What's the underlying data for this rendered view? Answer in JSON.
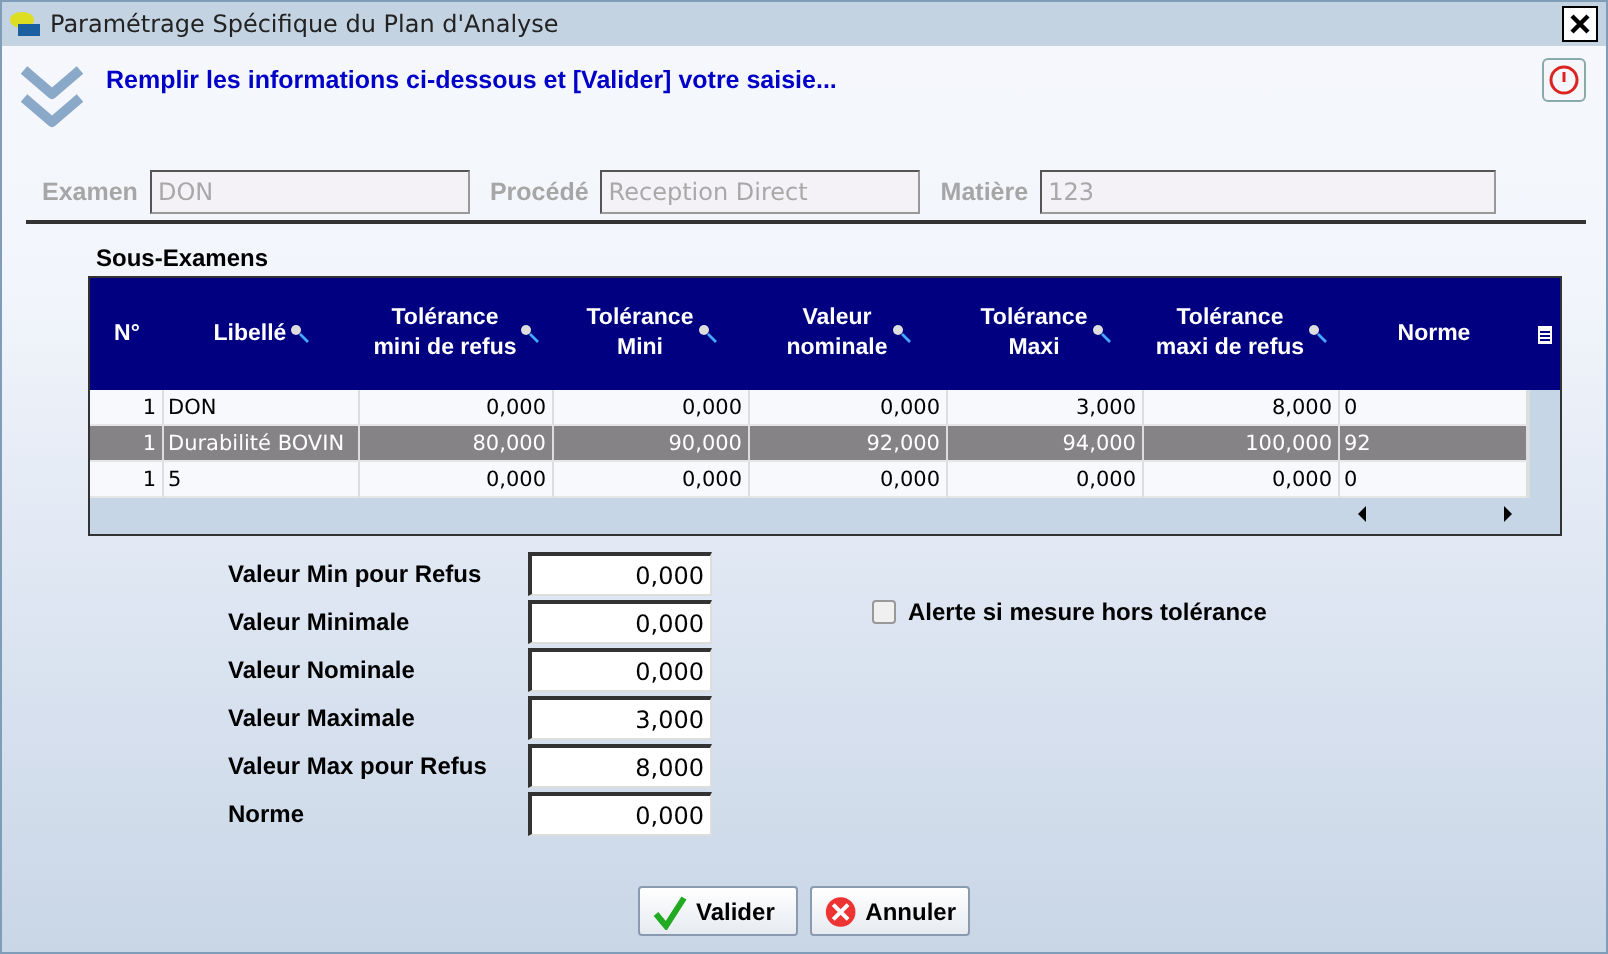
{
  "window": {
    "title": "Paramétrage Spécifique du Plan d'Analyse"
  },
  "instruction": "Remplir les informations ci-dessous et [Valider] votre saisie...",
  "header_fields": [
    {
      "label": "Examen",
      "value": "DON",
      "disabled": true
    },
    {
      "label": "Procédé",
      "value": "Reception Direct",
      "disabled": true
    },
    {
      "label": "Matière",
      "value": "123",
      "disabled": true
    }
  ],
  "table": {
    "title": "Sous-Examens",
    "columns": [
      {
        "label": "N°",
        "search": false
      },
      {
        "label": "Libellé",
        "search": true
      },
      {
        "label": "Tolérance\nmini de refus",
        "search": true
      },
      {
        "label": "Tolérance\nMini",
        "search": true
      },
      {
        "label": "Valeur\nnominale",
        "search": true
      },
      {
        "label": "Tolérance\nMaxi",
        "search": true
      },
      {
        "label": "Tolérance\nmaxi de refus",
        "search": true
      },
      {
        "label": "Norme",
        "search": false
      }
    ],
    "rows": [
      {
        "selected": false,
        "cells": [
          "1",
          "DON",
          "0,000",
          "0,000",
          "0,000",
          "3,000",
          "8,000",
          "0"
        ]
      },
      {
        "selected": true,
        "cells": [
          "1",
          "Durabilité BOVIN",
          "80,000",
          "90,000",
          "92,000",
          "94,000",
          "100,000",
          "92"
        ]
      },
      {
        "selected": false,
        "cells": [
          "1",
          "5",
          "0,000",
          "0,000",
          "0,000",
          "0,000",
          "0,000",
          "0"
        ]
      }
    ]
  },
  "form_fields": [
    {
      "label": "Valeur Min pour Refus",
      "value": "0,000"
    },
    {
      "label": "Valeur Minimale",
      "value": "0,000"
    },
    {
      "label": "Valeur Nominale",
      "value": "0,000"
    },
    {
      "label": "Valeur Maximale",
      "value": "3,000"
    },
    {
      "label": "Valeur Max pour Refus",
      "value": "8,000"
    },
    {
      "label": "Norme",
      "value": "0,000"
    }
  ],
  "alert_checkbox": {
    "label": "Alerte si mesure hors tolérance",
    "checked": false
  },
  "buttons": [
    {
      "kind": "ok",
      "label": "Valider"
    },
    {
      "kind": "cancel",
      "label": "Annuler"
    }
  ]
}
